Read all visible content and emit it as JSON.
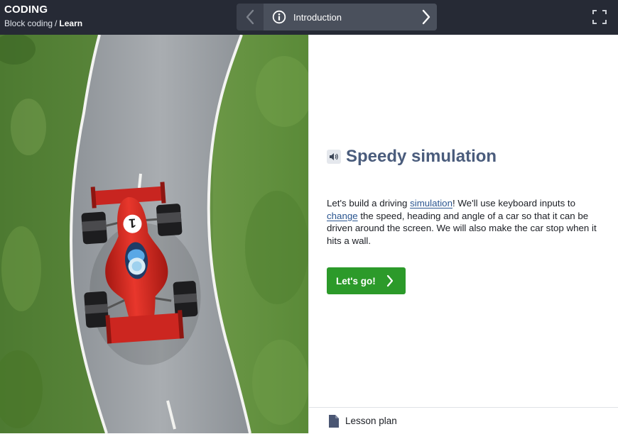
{
  "header": {
    "app_title": "CODING",
    "breadcrumb": {
      "parent": "Block coding",
      "separator": "/",
      "current": "Learn"
    }
  },
  "step_nav": {
    "previous_icon": "chevron-left-icon",
    "info_icon": "info-icon",
    "current_step": "Introduction",
    "next_icon": "chevron-right-icon"
  },
  "fullscreen_icon": "fullscreen-icon",
  "scene": {
    "car_number": "1"
  },
  "lesson": {
    "speaker_icon": "speaker-icon",
    "title": "Speedy simulation",
    "intro": {
      "t1": "Let's build a driving ",
      "term1": "simulation",
      "t2": "! We'll use keyboard inputs to ",
      "term2": "change",
      "t3": " the speed, heading and angle of a car so that it can be driven around the screen. We will also make the car stop when it hits a wall."
    },
    "go_button": "Let's go!"
  },
  "footer": {
    "doc_icon": "document-icon",
    "lesson_plan": "Lesson plan"
  },
  "colors": {
    "topbar": "#262a35",
    "title_accent": "#4a5c7c",
    "link": "#2a5590",
    "button_green": "#2c9a2a",
    "grass": "#5d8a3e",
    "road": "#9a9ea3",
    "car_red": "#d42a22"
  }
}
